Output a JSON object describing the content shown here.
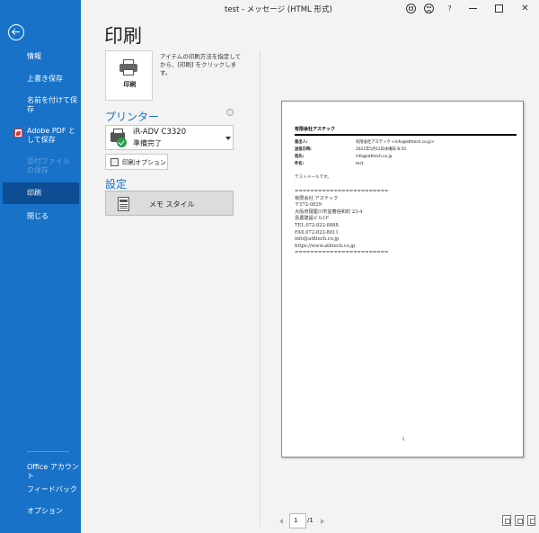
{
  "window": {
    "title": "test  -  メッセージ (HTML 形式)",
    "help": "?",
    "close": "✕"
  },
  "sidebar": {
    "items": [
      {
        "label": "情報"
      },
      {
        "label": "上書き保存"
      },
      {
        "label": "名前を付けて保存"
      },
      {
        "label": "Adobe PDF として保存"
      },
      {
        "label": "添付ファイルの保存"
      },
      {
        "label": "印刷"
      },
      {
        "label": "閉じる"
      }
    ],
    "bottom": [
      {
        "label": "Office アカウント"
      },
      {
        "label": "フィードバック"
      },
      {
        "label": "オプション"
      }
    ]
  },
  "print": {
    "heading": "印刷",
    "button_label": "印刷",
    "description": "アイテムの印刷方法を指定してから、[印刷] をクリックします。",
    "printer_section": "プリンター",
    "info": "i",
    "printer_name": "iR-ADV C3320",
    "printer_status": "準備完了",
    "options_label": "印刷オプション",
    "settings_section": "設定",
    "style_label": "メモ スタイル"
  },
  "preview": {
    "company": "有限会社アステック",
    "fields": [
      {
        "key": "差出人:",
        "value": "有限会社アステック <info@athtech.co.jp>"
      },
      {
        "key": "送信日時:",
        "value": "2021年5月12日水曜日 8:10"
      },
      {
        "key": "宛先:",
        "value": "info@athtech.co.jp"
      },
      {
        "key": "件名:",
        "value": "test"
      }
    ],
    "body_line": "テストメールです。",
    "signature": "========================\n有限会社 アステック\n〒572-0829\n大阪府寝屋川市宜春信和町 23-4\n島農建設ビル1F\nTEL.072-822-8888\nFAX.072-822-8811\ninfo@athtech.co.jp\nhttps://www.athtech.co.jp\n========================",
    "page_number": "1"
  },
  "pager": {
    "current": "1",
    "total": "/1"
  }
}
